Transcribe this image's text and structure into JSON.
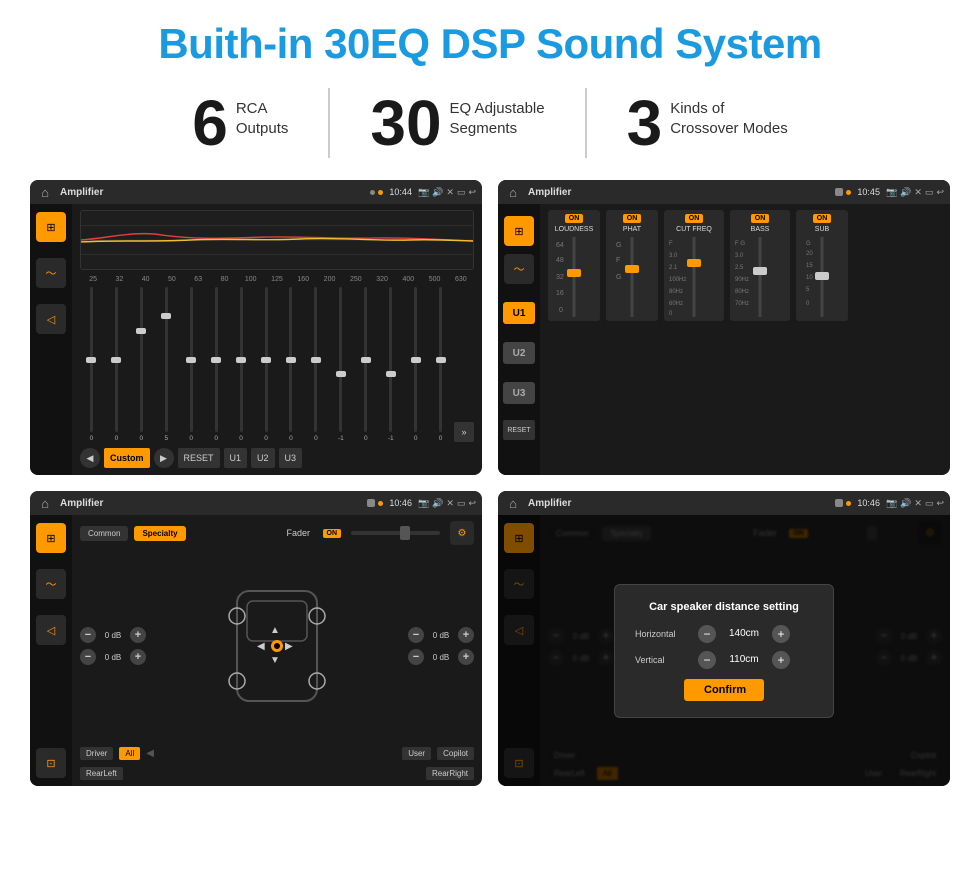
{
  "title": "Buith-in 30EQ DSP Sound System",
  "stats": [
    {
      "number": "6",
      "line1": "RCA",
      "line2": "Outputs"
    },
    {
      "number": "30",
      "line1": "EQ Adjustable",
      "line2": "Segments"
    },
    {
      "number": "3",
      "line1": "Kinds of",
      "line2": "Crossover Modes"
    }
  ],
  "screens": {
    "screen1": {
      "status_title": "Amplifier",
      "time": "10:44",
      "freq_labels": [
        "25",
        "32",
        "40",
        "50",
        "63",
        "80",
        "100",
        "125",
        "160",
        "200",
        "250",
        "320",
        "400",
        "500",
        "630"
      ],
      "slider_values": [
        "0",
        "0",
        "0",
        "5",
        "0",
        "0",
        "0",
        "0",
        "0",
        "0",
        "-1",
        "0",
        "-1"
      ],
      "buttons": [
        "Custom",
        "RESET",
        "U1",
        "U2",
        "U3"
      ]
    },
    "screen2": {
      "status_title": "Amplifier",
      "time": "10:45",
      "modules": [
        "LOUDNESS",
        "PHAT",
        "CUT FREQ",
        "BASS",
        "SUB"
      ],
      "u_labels": [
        "U1",
        "U2",
        "U3"
      ],
      "reset": "RESET"
    },
    "screen3": {
      "status_title": "Amplifier",
      "time": "10:46",
      "tabs": [
        "Common",
        "Specialty"
      ],
      "fader_label": "Fader",
      "db_values": [
        "0 dB",
        "0 dB",
        "0 dB",
        "0 dB"
      ],
      "bottom_labels": [
        "Driver",
        "All",
        "Copilot",
        "RearLeft",
        "User",
        "RearRight"
      ]
    },
    "screen4": {
      "status_title": "Amplifier",
      "time": "10:46",
      "tabs": [
        "Common",
        "Specialty"
      ],
      "dialog": {
        "title": "Car speaker distance setting",
        "horizontal_label": "Horizontal",
        "horizontal_value": "140cm",
        "vertical_label": "Vertical",
        "vertical_value": "110cm",
        "db_values": [
          "0 dB",
          "0 dB"
        ],
        "confirm_label": "Confirm"
      },
      "bottom_labels": [
        "Driver",
        "Copilot",
        "RearLeft",
        "User",
        "RearRight"
      ]
    }
  }
}
